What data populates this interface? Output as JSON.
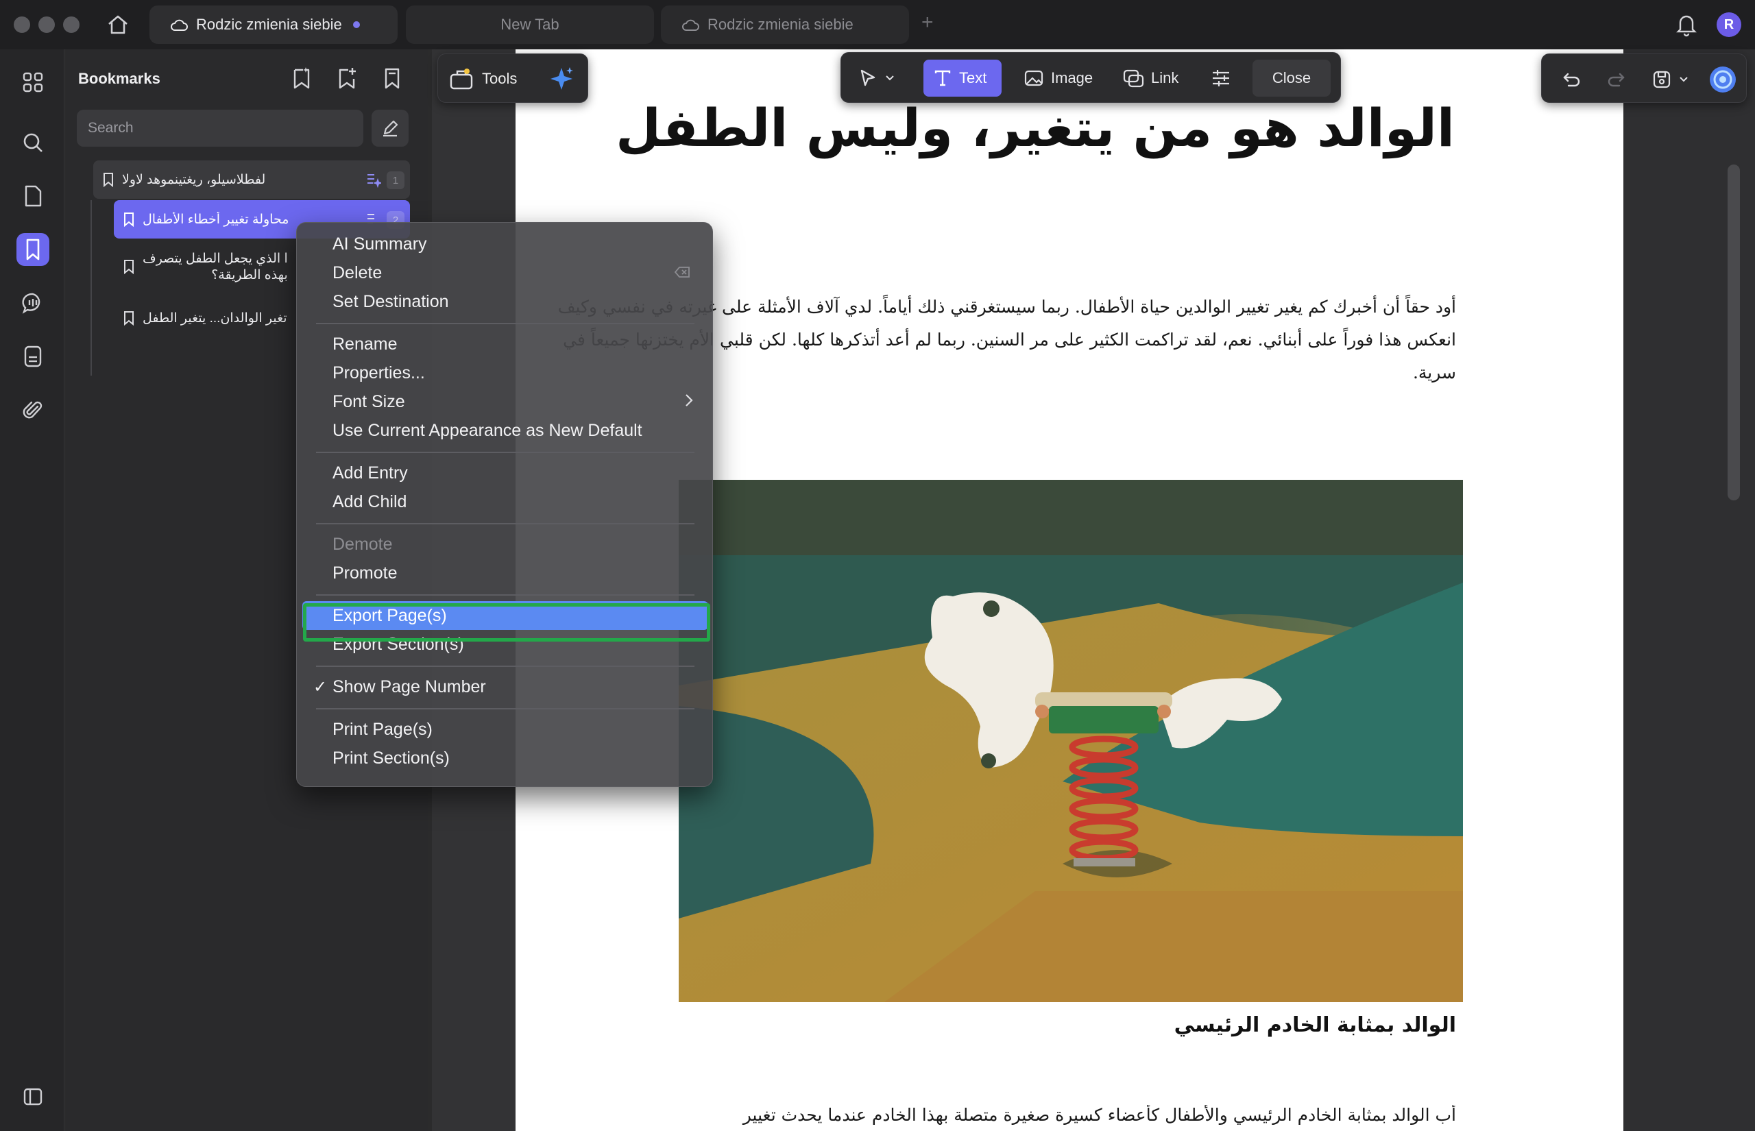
{
  "window": {
    "tabs": [
      {
        "label": "Rodzic zmienia siebie",
        "active": true
      },
      {
        "label": "New Tab",
        "active": false
      },
      {
        "label": "Rodzic zmienia siebie",
        "active": false
      }
    ],
    "avatar_initial": "R"
  },
  "bookmarks": {
    "title": "Bookmarks",
    "search_placeholder": "Search",
    "items": [
      {
        "label": "لفطلاسيلو، ريغتينموهد لاولا",
        "page": "1"
      },
      {
        "label": "محاولة تغيير أخطاء الأطفال",
        "page": "2"
      },
      {
        "label": "ا الذي يجعل الطفل يتصرف",
        "label2": "بهذه الطريقة؟"
      },
      {
        "label": "تغير الوالدان... يتغير الطفل"
      }
    ]
  },
  "toolbar": {
    "tools_label": "Tools",
    "text_label": "Text",
    "image_label": "Image",
    "link_label": "Link",
    "close_label": "Close",
    "accent": "#6c68ef"
  },
  "document": {
    "title": "الوالد هو من يتغير، وليس الطفل",
    "paragraph": "أود حقاً أن أخبرك كم يغير تغيير الوالدين حياة الأطفال. ربما سيستغرقني ذلك أياماً. لدي آلاف الأمثلة على غيرته في نفسي وكيف انعكس هذا فوراً على أبنائي. نعم، لقد تراكمت الكثير على مر السنين. ربما لم أعد أتذكرها كلها. لكن قلبي الأم يختزنها جميعاً في سرية.",
    "caption": "الوالد بمثابة الخادم الرئيسي",
    "bottom_text": "أب الوالد بمثابة الخادم الرئيسي والأطفال كأعضاء كسيرة صغيرة متصلة بهذا الخادم عندما يحدث تغيير"
  },
  "context_menu": {
    "items": [
      {
        "label": "AI Summary"
      },
      {
        "label": "Delete"
      },
      {
        "label": "Set Destination"
      },
      {
        "label": "Rename"
      },
      {
        "label": "Properties..."
      },
      {
        "label": "Font Size"
      },
      {
        "label": "Use Current Appearance as New Default"
      },
      {
        "label": "Add Entry"
      },
      {
        "label": "Add Child"
      },
      {
        "label": "Demote",
        "disabled": true
      },
      {
        "label": "Promote"
      },
      {
        "label": "Export Page(s)",
        "highlighted": true
      },
      {
        "label": "Export Section(s)"
      },
      {
        "label": "Show Page Number",
        "checked": true
      },
      {
        "label": "Print Page(s)"
      },
      {
        "label": "Print Section(s)"
      }
    ],
    "highlight_color": "#5b8af2",
    "annotation_color": "#23a84a"
  }
}
